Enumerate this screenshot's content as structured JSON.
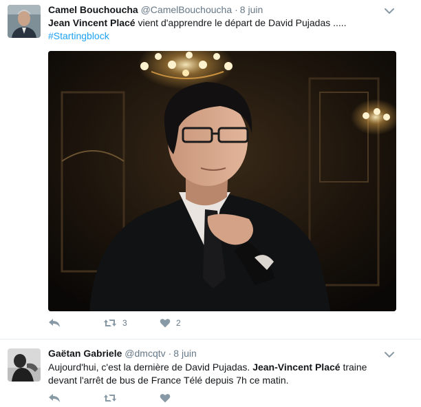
{
  "tweets": [
    {
      "author": {
        "name": "Camel Bouchoucha",
        "handle": "@CamelBouchoucha"
      },
      "time": "8 juin",
      "text": {
        "mention": "Jean Vincent Placé",
        "rest": " vient d'apprendre le départ de David Pujadas .....",
        "hashtag": "#Startingblock"
      },
      "has_media": true,
      "actions": {
        "retweets": "3",
        "likes": "2"
      }
    },
    {
      "author": {
        "name": "Gaëtan Gabriele",
        "handle": "@dmcqtv"
      },
      "time": "8 juin",
      "text": {
        "part1": "Aujourd'hui, c'est la dernière de David Pujadas. ",
        "mention": "Jean-Vincent Placé",
        "part2": " traine",
        "line2": "devant l'arrêt de bus de France Télé depuis 7h ce matin."
      }
    }
  ],
  "icons": {
    "reply": "reply-icon",
    "retweet": "retweet-icon",
    "like": "heart-icon",
    "more": "chevron-down-icon"
  },
  "colors": {
    "link": "#1da1f2",
    "muted": "#657786",
    "icon": "#8899a6"
  }
}
